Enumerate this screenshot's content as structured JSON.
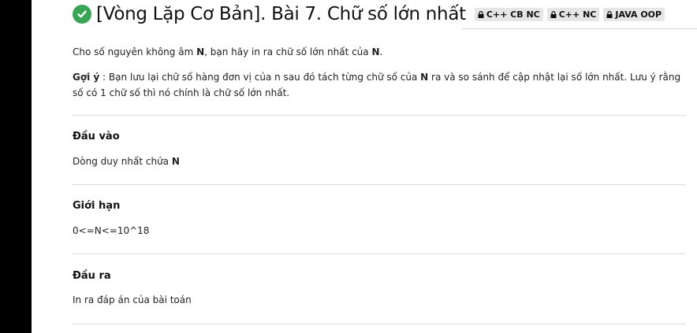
{
  "problem": {
    "title": "[Vòng Lặp Cơ Bản]. Bài 7. Chữ số lớn nhất",
    "tags": [
      "C++ CB NC",
      "C++ NC",
      "JAVA OOP"
    ],
    "statement_pre": "Cho số nguyên không âm ",
    "statement_n": "N",
    "statement_mid": ", bạn hãy in ra chữ số lớn nhất của ",
    "statement_n2": "N",
    "statement_end": ".",
    "hint_label": "Gợi ý",
    "hint_pre": " : Bạn lưu lại chữ số hàng đơn vị của n sau đó tách từng chữ số của ",
    "hint_n": "N",
    "hint_post": " ra và so sánh để cập nhật lại số lớn nhất. Lưu ý rằng số có 1 chữ số thì nó chính là chữ số lớn nhất."
  },
  "sections": {
    "input_heading": "Đầu vào",
    "input_text_pre": "Dòng duy nhất chứa ",
    "input_text_n": "N",
    "limits_heading": "Giới hạn",
    "limits_text": "0<=N<=10^18",
    "output_heading": "Đầu ra",
    "output_text": "In ra đáp án của bài toán"
  },
  "colors": {
    "check": "#3aa655",
    "tag_bg": "#e6e6e6",
    "sidebar": "#000000"
  }
}
